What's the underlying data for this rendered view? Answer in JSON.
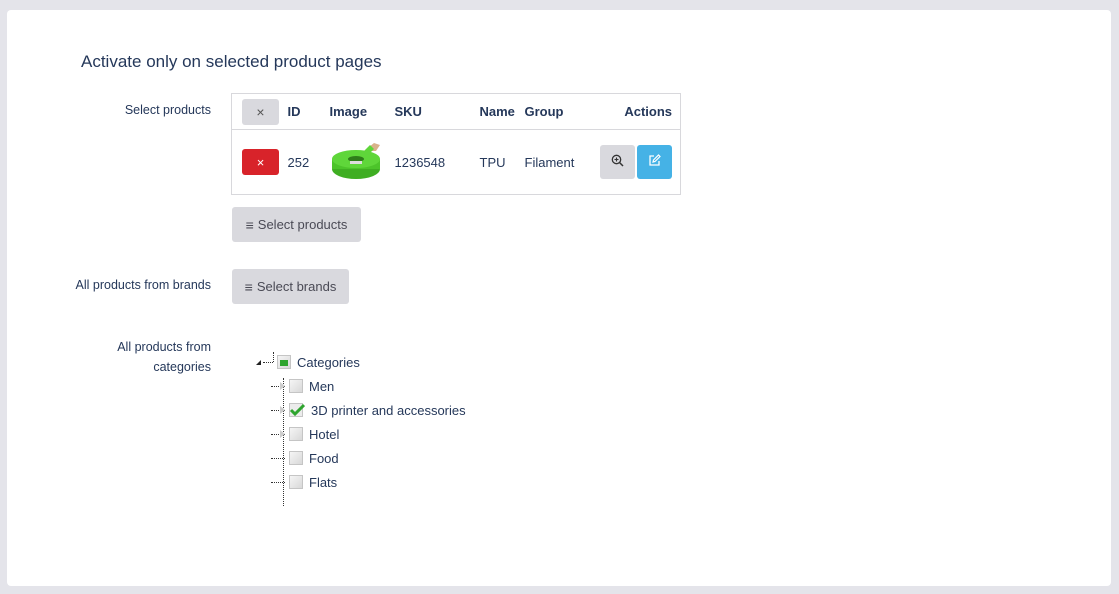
{
  "section": {
    "title": "Activate only on selected product pages"
  },
  "labels": {
    "select_products": "Select products",
    "brands": "All products from brands",
    "categories_line1": "All products from",
    "categories_line2": "categories"
  },
  "product_table": {
    "clear_all_icon": "×",
    "columns": [
      "ID",
      "Image",
      "SKU",
      "Name",
      "Group",
      "Actions"
    ],
    "rows": [
      {
        "remove_icon": "×",
        "id": "252",
        "image": "green-filament-spool",
        "sku": "1236548",
        "name": "TPU",
        "group": "Filament",
        "actions": [
          "zoom-in-icon",
          "edit-icon"
        ]
      }
    ]
  },
  "buttons": {
    "select_products": "Select products",
    "select_brands": "Select brands",
    "menu_icon": "≡"
  },
  "category_tree": {
    "root": {
      "label": "Categories",
      "state": "partial"
    },
    "children": [
      {
        "label": "Men",
        "checked": false,
        "expandable": true
      },
      {
        "label": "3D printer and accessories",
        "checked": true,
        "expandable": true
      },
      {
        "label": "Hotel",
        "checked": false,
        "expandable": true
      },
      {
        "label": "Food",
        "checked": false,
        "expandable": false
      },
      {
        "label": "Flats",
        "checked": false,
        "expandable": false
      }
    ]
  },
  "colors": {
    "remove": "#d8232a",
    "edit": "#45b2e6",
    "neutral_button": "#d9d9de",
    "text": "#25385a",
    "check": "#2fa52f"
  }
}
